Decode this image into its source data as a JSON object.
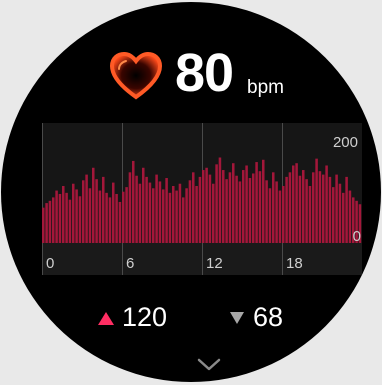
{
  "heart_rate": {
    "value": "80",
    "unit": "bpm"
  },
  "chart_data": {
    "type": "bar",
    "title": "",
    "xlabel": "",
    "ylabel": "",
    "ylim": [
      0,
      200
    ],
    "xlim": [
      0,
      24
    ],
    "x_ticks": [
      "0",
      "6",
      "12",
      "18"
    ],
    "y_ticks": [
      "200",
      "0"
    ],
    "grid": true,
    "values": [
      62,
      70,
      74,
      80,
      92,
      86,
      100,
      88,
      76,
      104,
      94,
      82,
      110,
      120,
      96,
      132,
      112,
      92,
      116,
      88,
      80,
      106,
      86,
      72,
      90,
      98,
      124,
      144,
      118,
      104,
      132,
      116,
      106,
      96,
      120,
      108,
      94,
      114,
      88,
      100,
      92,
      104,
      80,
      96,
      110,
      124,
      100,
      116,
      128,
      132,
      120,
      104,
      138,
      150,
      128,
      112,
      124,
      140,
      118,
      108,
      128,
      136,
      114,
      122,
      142,
      126,
      146,
      110,
      96,
      124,
      108,
      92,
      100,
      116,
      124,
      136,
      140,
      118,
      128,
      112,
      100,
      124,
      148,
      126,
      120,
      136,
      116,
      98,
      120,
      104,
      88,
      116,
      92,
      80,
      74,
      68
    ],
    "color": "#a3173a"
  },
  "stats": {
    "max": "120",
    "min": "68"
  },
  "colors": {
    "accent": "#ff2e63",
    "bar": "#a3173a",
    "background": "#000000"
  },
  "icons": {
    "heart": "heart-icon",
    "up": "up-arrow-icon",
    "down": "down-arrow-icon",
    "more": "chevron-down-icon"
  }
}
